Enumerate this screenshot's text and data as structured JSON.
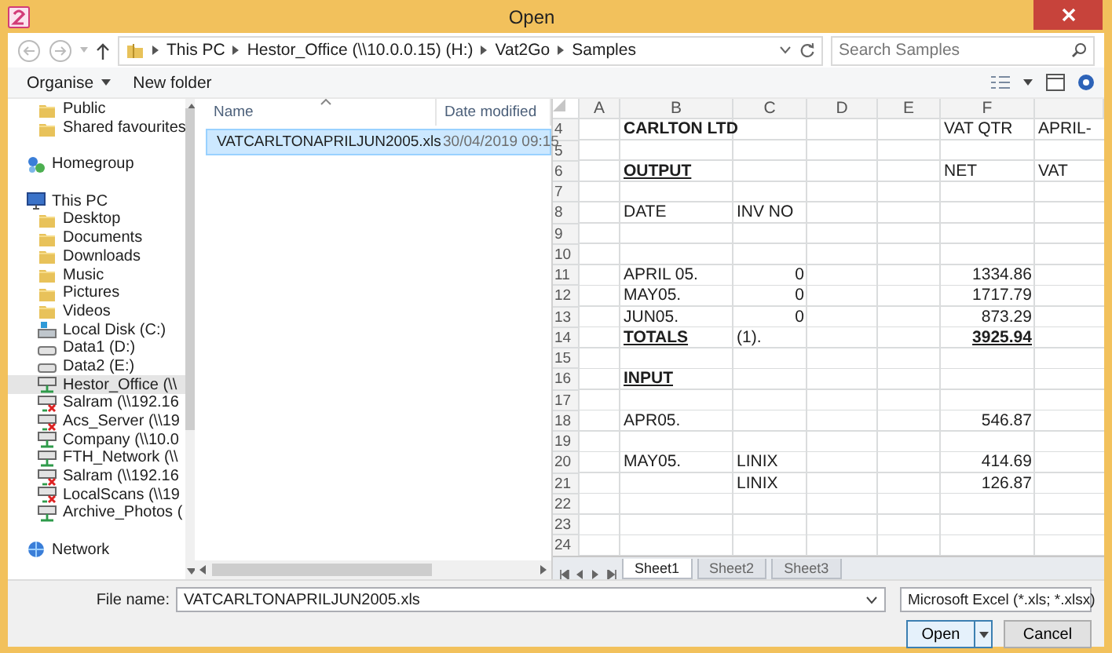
{
  "window": {
    "title": "Open"
  },
  "address_bar": {
    "path": [
      "This PC",
      "Hestor_Office (\\\\10.0.0.15) (H:)",
      "Vat2Go",
      "Samples"
    ]
  },
  "search": {
    "placeholder": "Search Samples"
  },
  "command_bar": {
    "buttons": [
      "Organise",
      "New folder"
    ]
  },
  "navigation": {
    "sections": [
      {
        "children": [
          {
            "label": "Public",
            "kind": "folder",
            "selected": false
          },
          {
            "label": "Shared favourites",
            "kind": "folder",
            "selected": false
          }
        ]
      },
      {
        "label": "Homegroup",
        "kind": "homegroup",
        "selected": false
      },
      {
        "label": "This PC",
        "kind": "computer",
        "selected": false,
        "children": [
          {
            "label": "Desktop",
            "kind": "folder",
            "selected": false
          },
          {
            "label": "Documents",
            "kind": "folder",
            "selected": false
          },
          {
            "label": "Downloads",
            "kind": "folder",
            "selected": false
          },
          {
            "label": "Music",
            "kind": "folder",
            "selected": false
          },
          {
            "label": "Pictures",
            "kind": "folder",
            "selected": false
          },
          {
            "label": "Videos",
            "kind": "folder",
            "selected": false
          },
          {
            "label": "Local Disk (C:)",
            "kind": "system",
            "selected": false
          },
          {
            "label": "Data1 (D:)",
            "kind": "drive",
            "selected": false
          },
          {
            "label": "Data2 (E:)",
            "kind": "drive",
            "selected": false
          },
          {
            "label": "Hestor_Office (\\\\",
            "kind": "share",
            "selected": true
          },
          {
            "label": "Salram (\\\\192.16",
            "kind": "offline",
            "selected": false
          },
          {
            "label": "Acs_Server (\\\\19",
            "kind": "offline",
            "selected": false
          },
          {
            "label": "Company (\\\\10.0",
            "kind": "share",
            "selected": false
          },
          {
            "label": "FTH_Network (\\\\",
            "kind": "share",
            "selected": false
          },
          {
            "label": "Salram (\\\\192.16",
            "kind": "offline",
            "selected": false
          },
          {
            "label": "LocalScans (\\\\19",
            "kind": "offline",
            "selected": false
          },
          {
            "label": "Archive_Photos (",
            "kind": "share",
            "selected": false
          }
        ]
      },
      {
        "label": "Network",
        "kind": "network",
        "selected": false
      }
    ]
  },
  "files": {
    "columns": [
      "Name",
      "Date modified"
    ],
    "rows": [
      {
        "name": "VATCARLTONAPRILJUN2005.xls",
        "date_modified": "30/04/2019 09:15",
        "selected": true
      }
    ]
  },
  "preview": {
    "columns": [
      "A",
      "B",
      "C",
      "D",
      "E",
      "F"
    ],
    "rows": [
      {
        "number": "4",
        "column_b": {
          "text": "CARLTON LTD",
          "kind": "bold"
        },
        "column_f": {
          "text": "VAT QTR",
          "kind": "plain"
        },
        "column_7": {
          "text": "APRIL-",
          "kind": "plain"
        }
      },
      {
        "number": "5"
      },
      {
        "number": "6",
        "column_b": {
          "text": "OUTPUT",
          "kind": "heading"
        },
        "column_f": {
          "text": "NET",
          "kind": "plain"
        },
        "column_7": {
          "text": "VAT",
          "kind": "plain"
        }
      },
      {
        "number": "7"
      },
      {
        "number": "8",
        "column_b": {
          "text": "DATE",
          "kind": "plain"
        },
        "column_c": {
          "text": "INV NO",
          "kind": "plain"
        }
      },
      {
        "number": "9"
      },
      {
        "number": "10"
      },
      {
        "number": "11",
        "column_b": {
          "text": "APRIL 05.",
          "kind": "plain"
        },
        "column_c": {
          "text": "0",
          "kind": "number"
        },
        "column_f": {
          "text": "1334.86",
          "kind": "number"
        }
      },
      {
        "number": "12",
        "column_b": {
          "text": "MAY05.",
          "kind": "plain"
        },
        "column_c": {
          "text": "0",
          "kind": "number"
        },
        "column_f": {
          "text": "1717.79",
          "kind": "number"
        }
      },
      {
        "number": "13",
        "column_b": {
          "text": "JUN05.",
          "kind": "plain"
        },
        "column_c": {
          "text": "0",
          "kind": "number"
        },
        "column_f": {
          "text": "873.29",
          "kind": "number"
        }
      },
      {
        "number": "14",
        "column_b": {
          "text": "TOTALS",
          "kind": "heading"
        },
        "column_c": {
          "text": "(1).",
          "kind": "plain"
        },
        "column_f": {
          "text": "3925.94",
          "kind": "total"
        }
      },
      {
        "number": "15"
      },
      {
        "number": "16",
        "column_b": {
          "text": "INPUT",
          "kind": "heading"
        }
      },
      {
        "number": "17"
      },
      {
        "number": "18",
        "column_b": {
          "text": "APR05.",
          "kind": "plain"
        },
        "column_f": {
          "text": "546.87",
          "kind": "number"
        }
      },
      {
        "number": "19"
      },
      {
        "number": "20",
        "column_b": {
          "text": "MAY05.",
          "kind": "plain"
        },
        "column_c": {
          "text": "LINIX",
          "kind": "plain"
        },
        "column_f": {
          "text": "414.69",
          "kind": "number"
        }
      },
      {
        "number": "21",
        "column_c": {
          "text": "LINIX",
          "kind": "plain"
        },
        "column_f": {
          "text": "126.87",
          "kind": "number"
        }
      },
      {
        "number": "22"
      },
      {
        "number": "23"
      },
      {
        "number": "24"
      }
    ],
    "sheets": [
      {
        "label": "Sheet1",
        "selected": true
      },
      {
        "label": "Sheet2",
        "selected": false
      },
      {
        "label": "Sheet3",
        "selected": false
      }
    ]
  },
  "file_name": {
    "label": "File name:",
    "value": "VATCARLTONAPRILJUN2005.xls"
  },
  "file_type": {
    "value": "Microsoft Excel (*.xls; *.xlsx)"
  },
  "buttons": [
    "Open",
    "Cancel"
  ]
}
